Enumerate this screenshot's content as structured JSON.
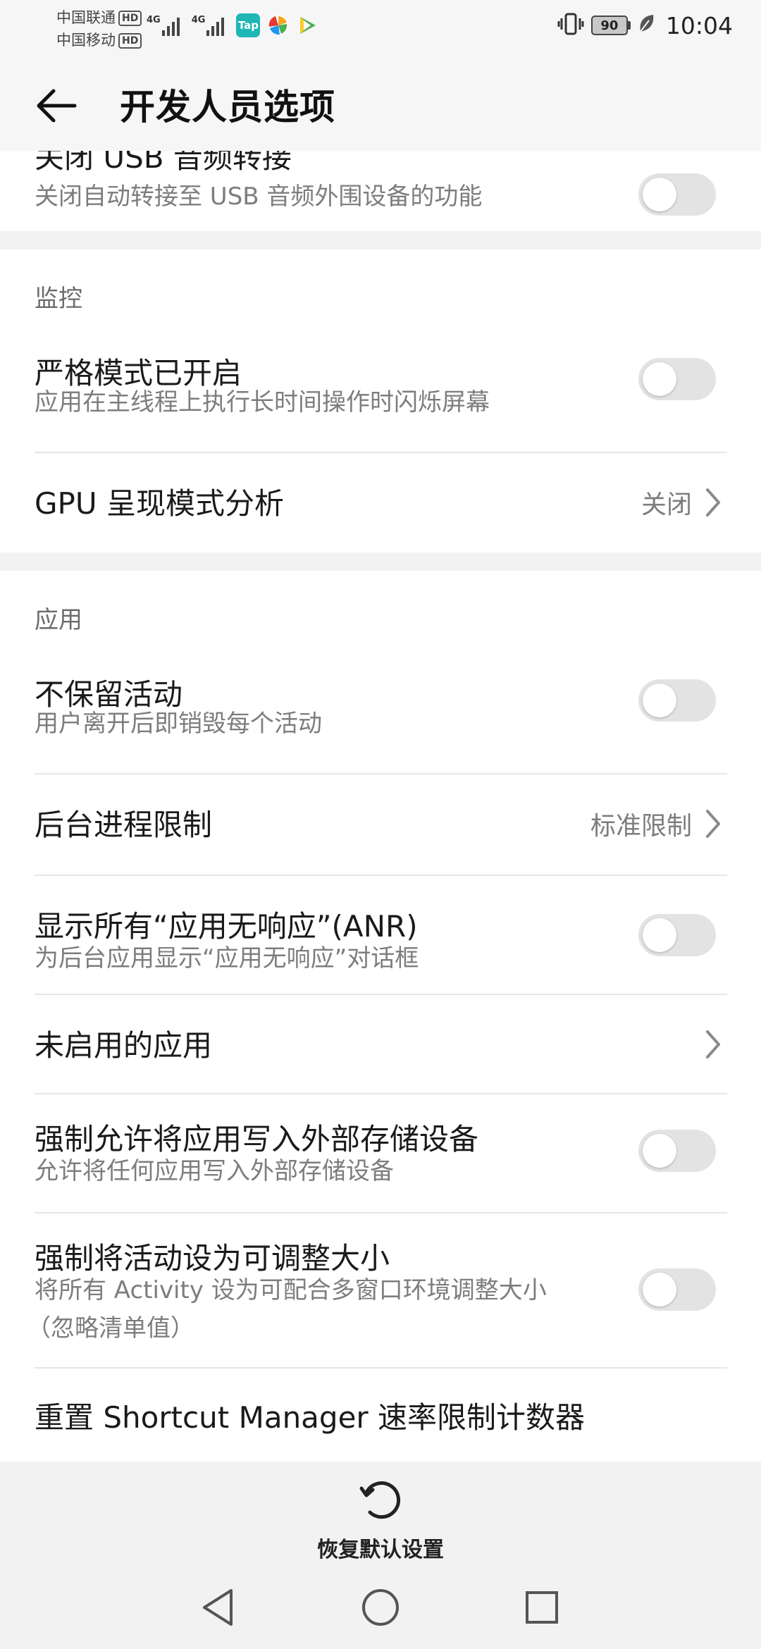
{
  "status_bar": {
    "carrier_1": "中国联通",
    "carrier_2": "中国移动",
    "hd_label": "HD",
    "network_1": "4G",
    "network_2": "4G",
    "tap_app_label": "Tap",
    "battery_level": "90",
    "time": "10:04"
  },
  "header": {
    "title": "开发人员选项"
  },
  "items": {
    "usb_audio": {
      "title": "关闭 USB 音频转接",
      "subtitle": "关闭自动转接至 USB 音频外围设备的功能",
      "enabled": false
    },
    "monitoring": {
      "section_title": "监控",
      "strict_mode": {
        "title": "严格模式已开启",
        "subtitle": "应用在主线程上执行长时间操作时闪烁屏幕",
        "enabled": false
      },
      "gpu_profile": {
        "title": "GPU 呈现模式分析",
        "value": "关闭"
      }
    },
    "apps": {
      "section_title": "应用",
      "dont_keep_activities": {
        "title": "不保留活动",
        "subtitle": "用户离开后即销毁每个活动",
        "enabled": false
      },
      "background_limit": {
        "title": "后台进程限制",
        "value": "标准限制"
      },
      "show_all_anr": {
        "title": "显示所有“应用无响应”(ANR)",
        "subtitle": "为后台应用显示“应用无响应”对话框",
        "enabled": false
      },
      "inactive_apps": {
        "title": "未启用的应用"
      },
      "force_external": {
        "title": "强制允许将应用写入外部存储设备",
        "subtitle": "允许将任何应用写入外部存储设备",
        "enabled": false
      },
      "force_resizable": {
        "title": "强制将活动设为可调整大小",
        "subtitle_line1": "将所有 Activity 设为可配合多窗口环境调整大小",
        "subtitle_line2": "（忽略清单值）",
        "enabled": false
      },
      "reset_shortcut": {
        "title": "重置 Shortcut Manager 速率限制计数器"
      }
    }
  },
  "bottom": {
    "reset_label": "恢复默认设置"
  },
  "icons": {
    "back": "arrow-left-icon",
    "chevron": "chevron-right-icon",
    "reset": "refresh-icon",
    "nav_back": "triangle-back-icon",
    "nav_home": "circle-home-icon",
    "nav_recents": "square-recents-icon"
  }
}
